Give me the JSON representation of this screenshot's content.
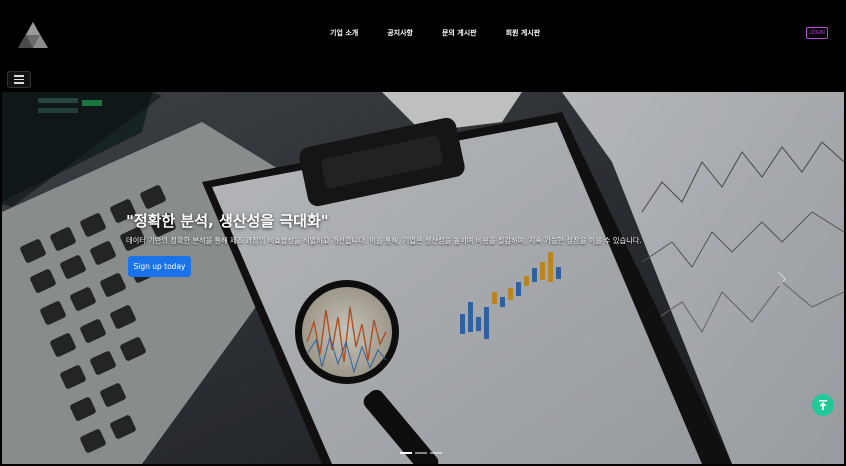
{
  "header": {
    "nav_items": [
      "기업 소개",
      "공지사항",
      "문의 게시판",
      "회원 게시판"
    ],
    "login_label": "LOGIN"
  },
  "hero": {
    "title": "\"정확한 분석, 생산성을 극대화\"",
    "description": "데이터 기반의 정확한 분석을 통해 제조 과정의 비효율성을 식별하고 개선합니다. 이를 통해, 기업은 생산성을 높이며 비용을 절감하며, 지속 가능한 성장을 이룰 수 있습니다.",
    "cta_label": "Sign up today",
    "slide_count": 3,
    "active_slide": 1
  },
  "colors": {
    "cta": "#1a73e8",
    "login_border": "#b44bd6",
    "scroll_top": "#20c997"
  },
  "icons": [
    "logo-triangle-icon",
    "hamburger-icon",
    "chevron-right-icon",
    "arrow-up-icon"
  ]
}
